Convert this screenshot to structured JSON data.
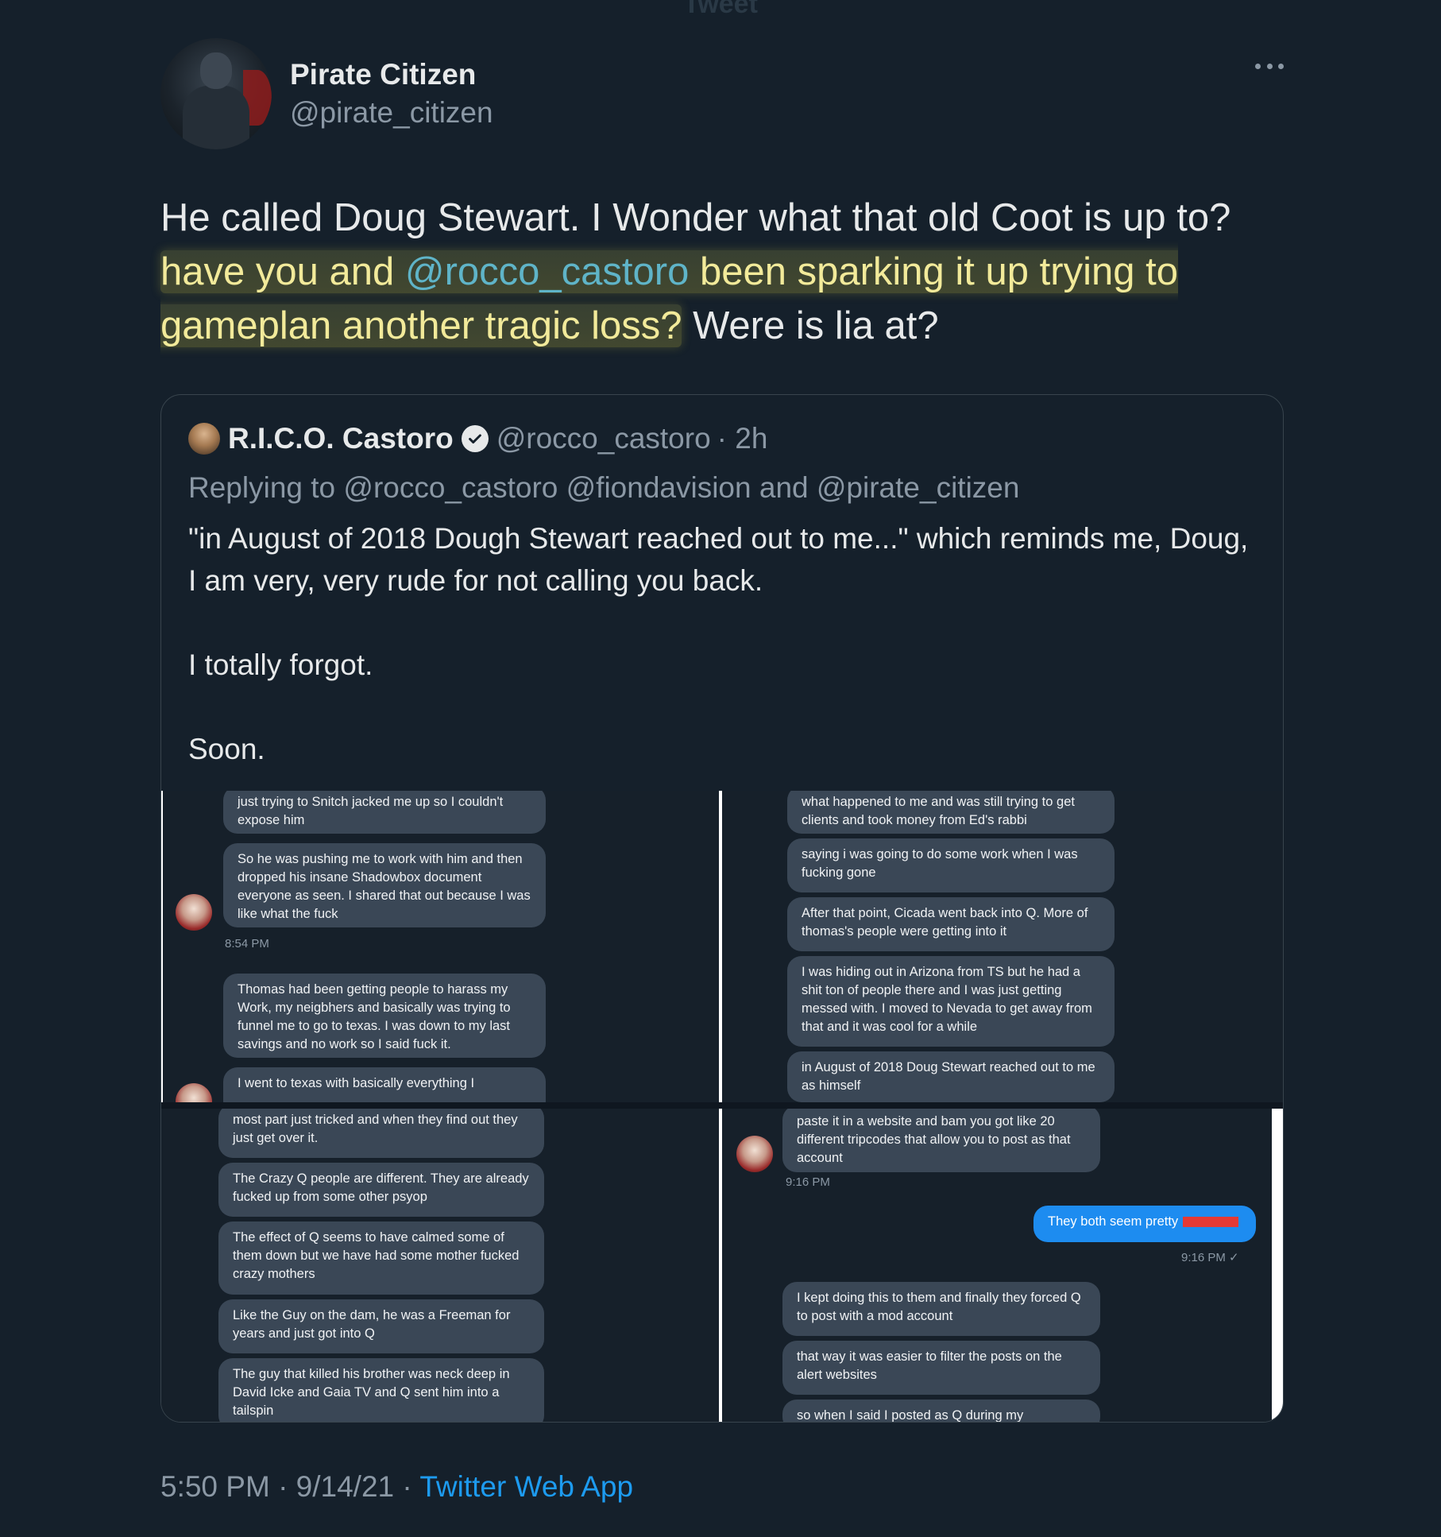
{
  "page": {
    "top_label": "Tweet"
  },
  "author": {
    "display_name": "Pirate Citizen",
    "handle": "@pirate_citizen"
  },
  "tweet": {
    "text_before": "He called Doug Stewart. I Wonder what that old Coot is up to? ",
    "highlight_1": "have you and ",
    "mention": "@rocco_castoro",
    "highlight_2": "  been sparking it up trying to gameplan another tragic loss?",
    "text_after": " Were is lia at?"
  },
  "quote": {
    "display_name": "R.I.C.O. Castoro",
    "handle": "@rocco_castoro",
    "time": "· 2h",
    "replying_to": "Replying to @rocco_castoro @fiondavision and @pirate_citizen",
    "paragraphs": [
      "\"in August of 2018 Dough Stewart reached out to me...\" which reminds me, Doug, I am very, very rude for not calling you back.",
      "I totally forgot.",
      "Soon."
    ]
  },
  "screenshots": {
    "p1": {
      "b1": "just trying to Snitch jacked me up so I couldn't expose him",
      "b2": "So he was pushing me to work with him and then dropped his insane Shadowbox document everyone as seen. I shared that out because I was like what the fuck",
      "ts1": "8:54 PM",
      "b3": "Thomas had been getting people to harass my Work, my neigbhers and basically was trying to funnel me to go to texas.  I was down to my last savings and no work so I said fuck it.",
      "b4": "I went to texas with basically everything I"
    },
    "p2": {
      "b1": "what happened to me and was still trying to get clients and took money from Ed's rabbi",
      "b2": "saying i was going to do some work when I was fucking gone",
      "b3": "After that point, Cicada went back into Q. More of thomas's people were getting into it",
      "b4": "I was hiding out in Arizona from TS but  he had a shit ton of people there and I was just getting messed with. I moved to Nevada to get away from that and it was cool for a while",
      "b5": "in August of 2018 Doug Stewart reached out to me as himself"
    },
    "p3": {
      "b1": "most part just tricked and when they find out they just get over it.",
      "b2": "The Crazy Q people are different. They are already fucked up from some other psyop",
      "b3": "The effect of Q seems to have calmed some of them down but we have had some mother fucked crazy mothers",
      "b4": "Like the Guy on the dam, he was a Freeman for years and just got into Q",
      "b5": "The guy that killed his brother was neck deep in David Icke and Gaia TV and Q sent him into a tailspin"
    },
    "p4": {
      "b1": "paste it in a website and bam you got like 20 different tripcodes that allow you to post as that account",
      "ts1": "9:16 PM",
      "out1": "They both seem pretty",
      "ts2": "9:16 PM ✓",
      "b2": "I kept doing this to them and finally they forced Q to post with a mod account",
      "b3": "that way it was easier to filter the posts on the alert websites",
      "b4": "so when I said I posted as Q during my"
    }
  },
  "footer": {
    "time": "5:50 PM · 9/14/21 · ",
    "app": "Twitter Web App"
  },
  "icons": {
    "more": "more-horizontal-icon",
    "verified": "verified-badge-icon"
  },
  "colors": {
    "background": "#15202b",
    "link": "#1d9bf0",
    "muted": "#8b98a5",
    "highlight": "#f2ea9a"
  }
}
